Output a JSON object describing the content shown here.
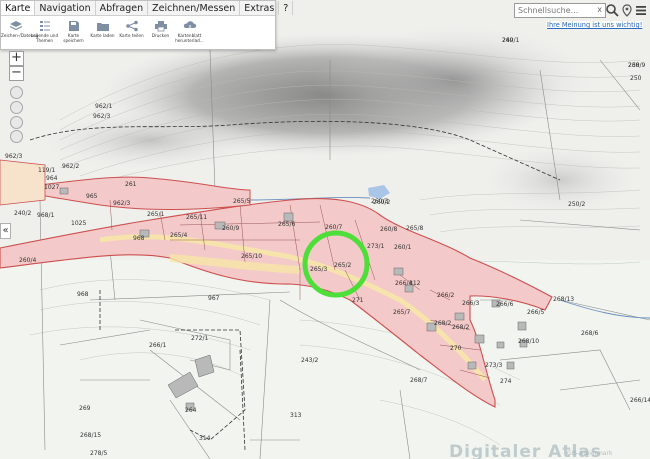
{
  "toolbar": {
    "tabs": [
      "Karte",
      "Navigation",
      "Abfragen",
      "Zeichnen/Messen",
      "Extras",
      "?"
    ],
    "active_tab": "Karte",
    "tools": [
      {
        "icon": "layers-icon",
        "label": "Zeichen-/Datensä"
      },
      {
        "icon": "legend-icon",
        "label": "Legende und Themen"
      },
      {
        "icon": "save-icon",
        "label": "Karte speichern"
      },
      {
        "icon": "folder-icon",
        "label": "Karte laden"
      },
      {
        "icon": "share-icon",
        "label": "Karte teilen"
      },
      {
        "icon": "print-icon",
        "label": "Drucken"
      },
      {
        "icon": "download-icon",
        "label": "Kartenblatt herunterlad..."
      }
    ]
  },
  "search": {
    "placeholder": "Schnellsuche...",
    "clear": "x"
  },
  "feedback_link": "Ihre Meinung ist uns wichtig!",
  "watermark": "Digitaler Atlas",
  "watermark_sub": "GIS-Steiermark",
  "parcels": [
    "249",
    "230",
    "250",
    "962/1",
    "962/3",
    "962/2",
    "119/1",
    "964",
    "1027",
    "965",
    "962/3",
    "265/1",
    "265/11",
    "265/5",
    "265/6",
    "260/7",
    "260/8",
    "260/3",
    "260/1",
    "962/3",
    "261",
    "260/2",
    "250/2",
    "240/2",
    "968/1",
    "1025",
    "968",
    "265/4",
    "265/10",
    "265/2",
    "265/3",
    "265/8",
    "260/9",
    "260/4",
    "968",
    "967",
    "271",
    "265/7",
    "266/2",
    "266/3",
    "266/6",
    "266/5",
    "266/4",
    "268/2",
    "268/6",
    "266/1",
    "272/1",
    "243/2",
    "270",
    "268/10",
    "268/7",
    "268/13",
    "269",
    "264",
    "313",
    "273/3",
    "274",
    "266/14",
    "268/15",
    "278/5",
    "314",
    "312",
    "273/1",
    "268/2",
    "260/1",
    "268/9"
  ]
}
